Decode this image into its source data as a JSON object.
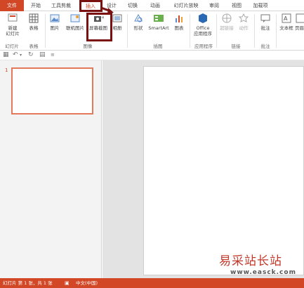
{
  "tabs": {
    "file": "文件",
    "home": "开始",
    "tools": "工具剪裁",
    "insert": "插入",
    "design": "设计",
    "transitions": "切换",
    "animations": "动画",
    "slideshow": "幻灯片放映",
    "review": "审阅",
    "view": "视图",
    "addins": "加载项"
  },
  "ribbon": {
    "new_slide": "新建\n幻灯片",
    "table": "表格",
    "picture": "图片",
    "online_picture": "联机图片",
    "screenshot": "屏幕截图",
    "album": "相册",
    "shapes": "形状",
    "smartart": "SmartArt",
    "chart": "图表",
    "office_apps": "Office\n应用程序",
    "hyperlink": "超链接",
    "action": "动作",
    "comment": "批注",
    "textbox": "文本框",
    "header_footer": "页眉",
    "groups": {
      "slides": "幻灯片",
      "tables": "表格",
      "images": "图像",
      "illustrations": "插图",
      "apps": "应用程序",
      "links": "链接",
      "comments": "批注"
    }
  },
  "thumbs": {
    "slide_number": "1"
  },
  "status": {
    "slide_info": "幻灯片 第 1 张，共 1 张",
    "language": "中文(中国)"
  },
  "watermark": {
    "main": "易采站长站",
    "sub": "www.easck.com"
  },
  "colors": {
    "accent": "#d24726",
    "highlight": "#7a1111"
  }
}
